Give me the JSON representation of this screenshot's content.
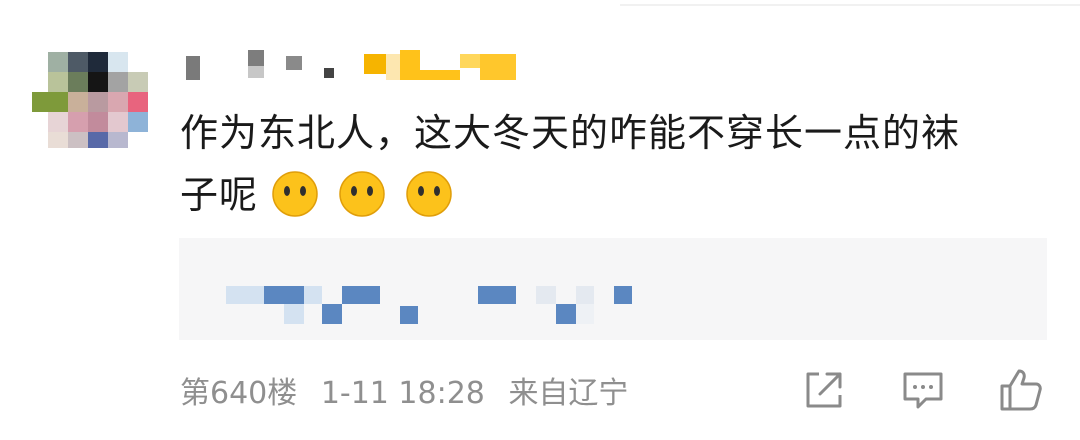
{
  "comment": {
    "line1": "作为东北人，这大冬天的咋能不穿长一点的袜",
    "line2": "子呢",
    "emojis": [
      "hushed-face-icon",
      "hushed-face-icon",
      "hushed-face-icon"
    ]
  },
  "meta": {
    "floor": "第640楼",
    "time": "1-11 18:28",
    "location": "来自辽宁"
  },
  "actions": [
    "share-icon",
    "comment-icon",
    "like-icon"
  ],
  "colors": {
    "text": "#1a1a1a",
    "meta": "#8f8f8f",
    "quote_bg": "#f6f6f7",
    "pixel_blue": "#5b87c1",
    "emoji_yellow": "#fcc21b"
  }
}
